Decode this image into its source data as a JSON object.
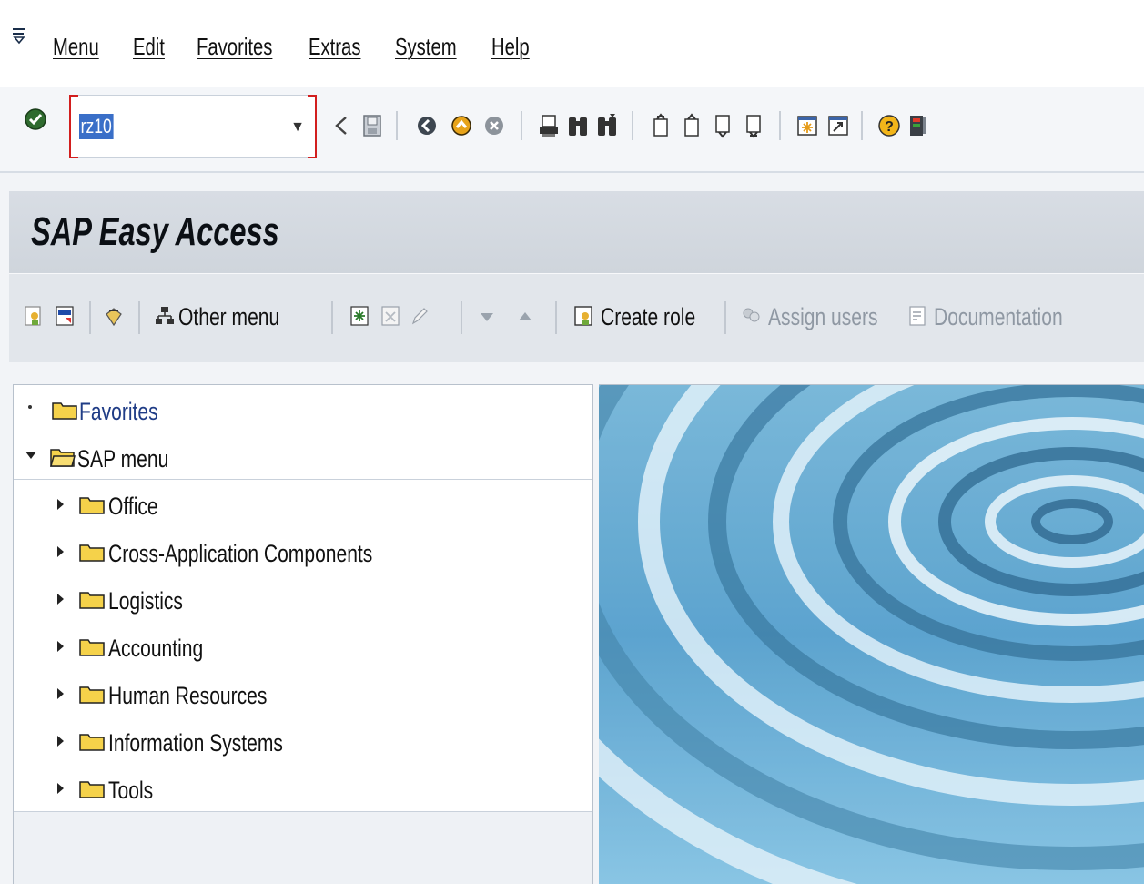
{
  "menubar": {
    "items": [
      {
        "label": "Menu"
      },
      {
        "label": "Edit"
      },
      {
        "label": "Favorites"
      },
      {
        "label": "Extras"
      },
      {
        "label": "System"
      },
      {
        "label": "Help"
      }
    ]
  },
  "command": {
    "value": "rz10",
    "icons": [
      "enter-icon",
      "back-icon",
      "save-icon",
      "exit-icon",
      "cancel-icon",
      "print-icon",
      "find-icon",
      "find-next-icon",
      "first-page-icon",
      "previous-page-icon",
      "next-page-icon",
      "last-page-icon",
      "create-session-icon",
      "shortcut-icon",
      "help-icon",
      "layout-menu-icon"
    ]
  },
  "title": {
    "text": "SAP Easy Access"
  },
  "toolbar": {
    "other_menu": "Other menu",
    "create_role": "Create role",
    "assign_users": "Assign users",
    "documentation": "Documentation"
  },
  "tree": {
    "favorites": "Favorites",
    "sap_menu": "SAP menu",
    "items": [
      {
        "label": "Office"
      },
      {
        "label": "Cross-Application Components"
      },
      {
        "label": "Logistics"
      },
      {
        "label": "Accounting"
      },
      {
        "label": "Human Resources"
      },
      {
        "label": "Information Systems"
      },
      {
        "label": "Tools"
      }
    ]
  },
  "colors": {
    "accent": "#3a6fc8",
    "focus_bracket": "#d21e1e",
    "folder": "#f5d24a",
    "water": "#4a9cc8"
  }
}
